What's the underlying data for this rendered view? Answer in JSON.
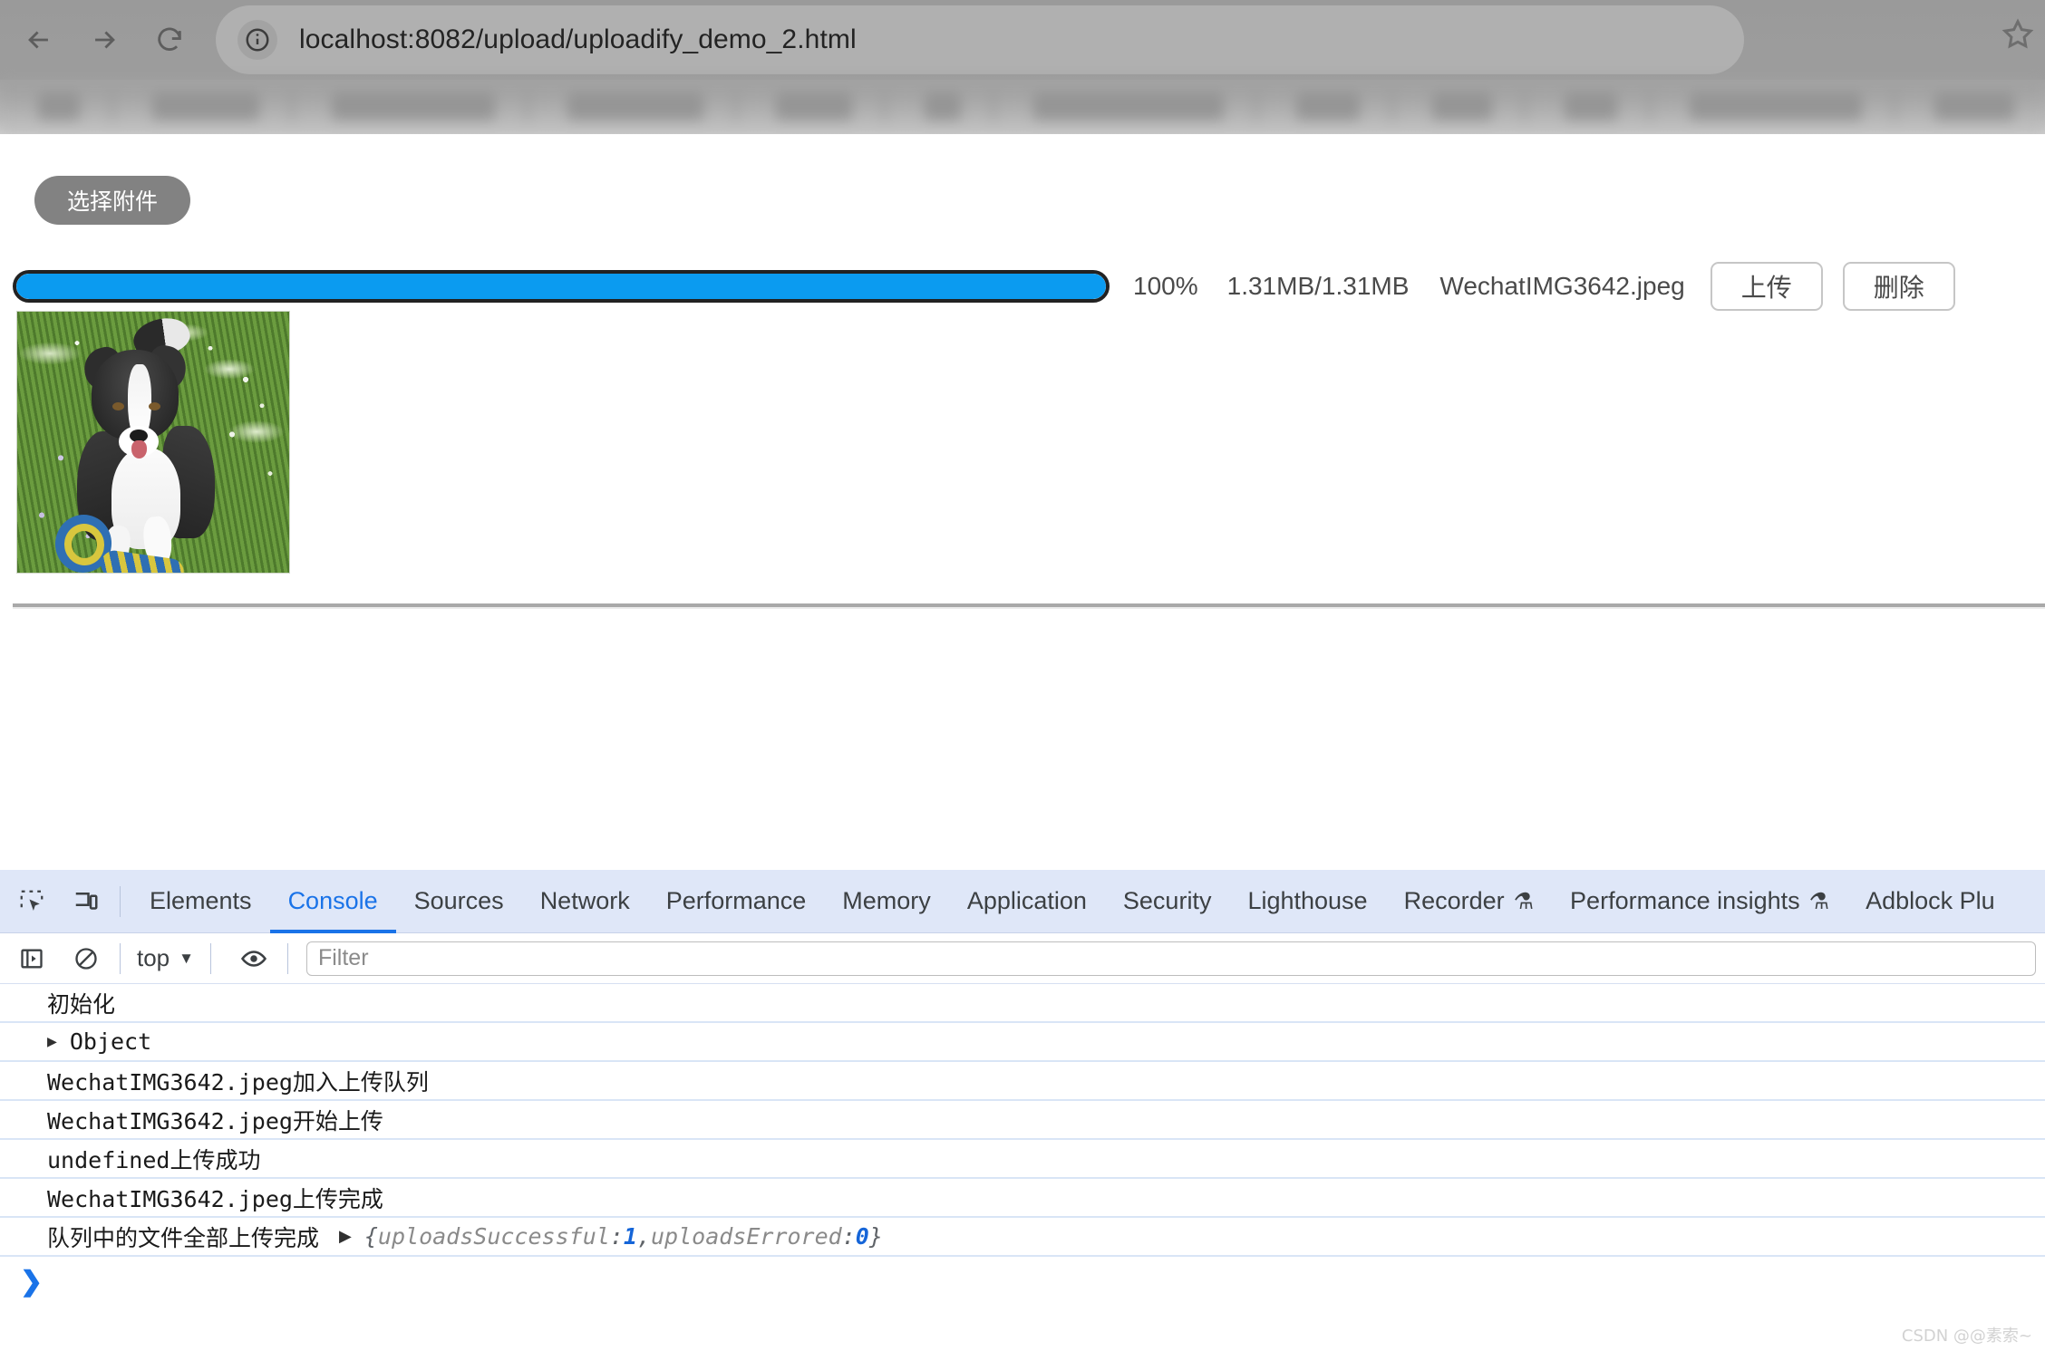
{
  "browser": {
    "url": "localhost:8082/upload/uploadify_demo_2.html",
    "back_label": "Back",
    "forward_label": "Forward",
    "reload_label": "Reload",
    "site_info_label": "View site information",
    "bookmark_label": "Bookmark this tab"
  },
  "page": {
    "select_button": "选择附件",
    "upload": {
      "percent": "100%",
      "progress_value": 100,
      "size": "1.31MB/1.31MB",
      "filename": "WechatIMG3642.jpeg",
      "upload_button": "上传",
      "delete_button": "删除",
      "progress_fill_color": "#0b9bf0",
      "thumbnail_alt": "WechatIMG3642.jpeg"
    }
  },
  "devtools": {
    "tabs": [
      {
        "label": "Elements",
        "active": false,
        "flask": false
      },
      {
        "label": "Console",
        "active": true,
        "flask": false
      },
      {
        "label": "Sources",
        "active": false,
        "flask": false
      },
      {
        "label": "Network",
        "active": false,
        "flask": false
      },
      {
        "label": "Performance",
        "active": false,
        "flask": false
      },
      {
        "label": "Memory",
        "active": false,
        "flask": false
      },
      {
        "label": "Application",
        "active": false,
        "flask": false
      },
      {
        "label": "Security",
        "active": false,
        "flask": false
      },
      {
        "label": "Lighthouse",
        "active": false,
        "flask": false
      },
      {
        "label": "Recorder",
        "active": false,
        "flask": true
      },
      {
        "label": "Performance insights",
        "active": false,
        "flask": true
      },
      {
        "label": "Adblock Plu",
        "active": false,
        "flask": false
      }
    ],
    "tab_labels": {
      "elements": "Elements",
      "console": "Console",
      "sources": "Sources",
      "network": "Network",
      "performance": "Performance",
      "memory": "Memory",
      "application": "Application",
      "security": "Security",
      "lighthouse": "Lighthouse",
      "recorder": "Recorder",
      "performance_insights": "Performance insights",
      "adblock": "Adblock Plu"
    },
    "flask_glyph": "⚗",
    "console_toolbar": {
      "context": "top",
      "caret": "▼",
      "filter_placeholder": "Filter",
      "filter_value": "",
      "sidebar_label": "Show console sidebar",
      "clear_label": "Clear console",
      "eye_label": "Create live expression"
    },
    "logs": [
      {
        "text": "初始化",
        "cjk": true,
        "expandable": false
      },
      {
        "text": "Object",
        "cjk": false,
        "expandable": true
      },
      {
        "text": "WechatIMG3642.jpeg加入上传队列",
        "cjk": false,
        "expandable": false
      },
      {
        "text": "WechatIMG3642.jpeg开始上传",
        "cjk": false,
        "expandable": false
      },
      {
        "text": "undefined上传成功",
        "cjk": false,
        "expandable": false
      },
      {
        "text": "WechatIMG3642.jpeg上传完成",
        "cjk": false,
        "expandable": false
      }
    ],
    "final_log": {
      "text": "队列中的文件全部上传完成",
      "arrow": "▶",
      "open_brace": "{",
      "key1": "uploadsSuccessful",
      "colon1": ": ",
      "value1": "1",
      "comma": ", ",
      "key2": "uploadsErrored",
      "colon2": ": ",
      "value2": "0",
      "close_brace": "}"
    },
    "prompt_chevron": "❯",
    "accent_color": "#1a73e8"
  },
  "watermark": "CSDN @@素索~"
}
